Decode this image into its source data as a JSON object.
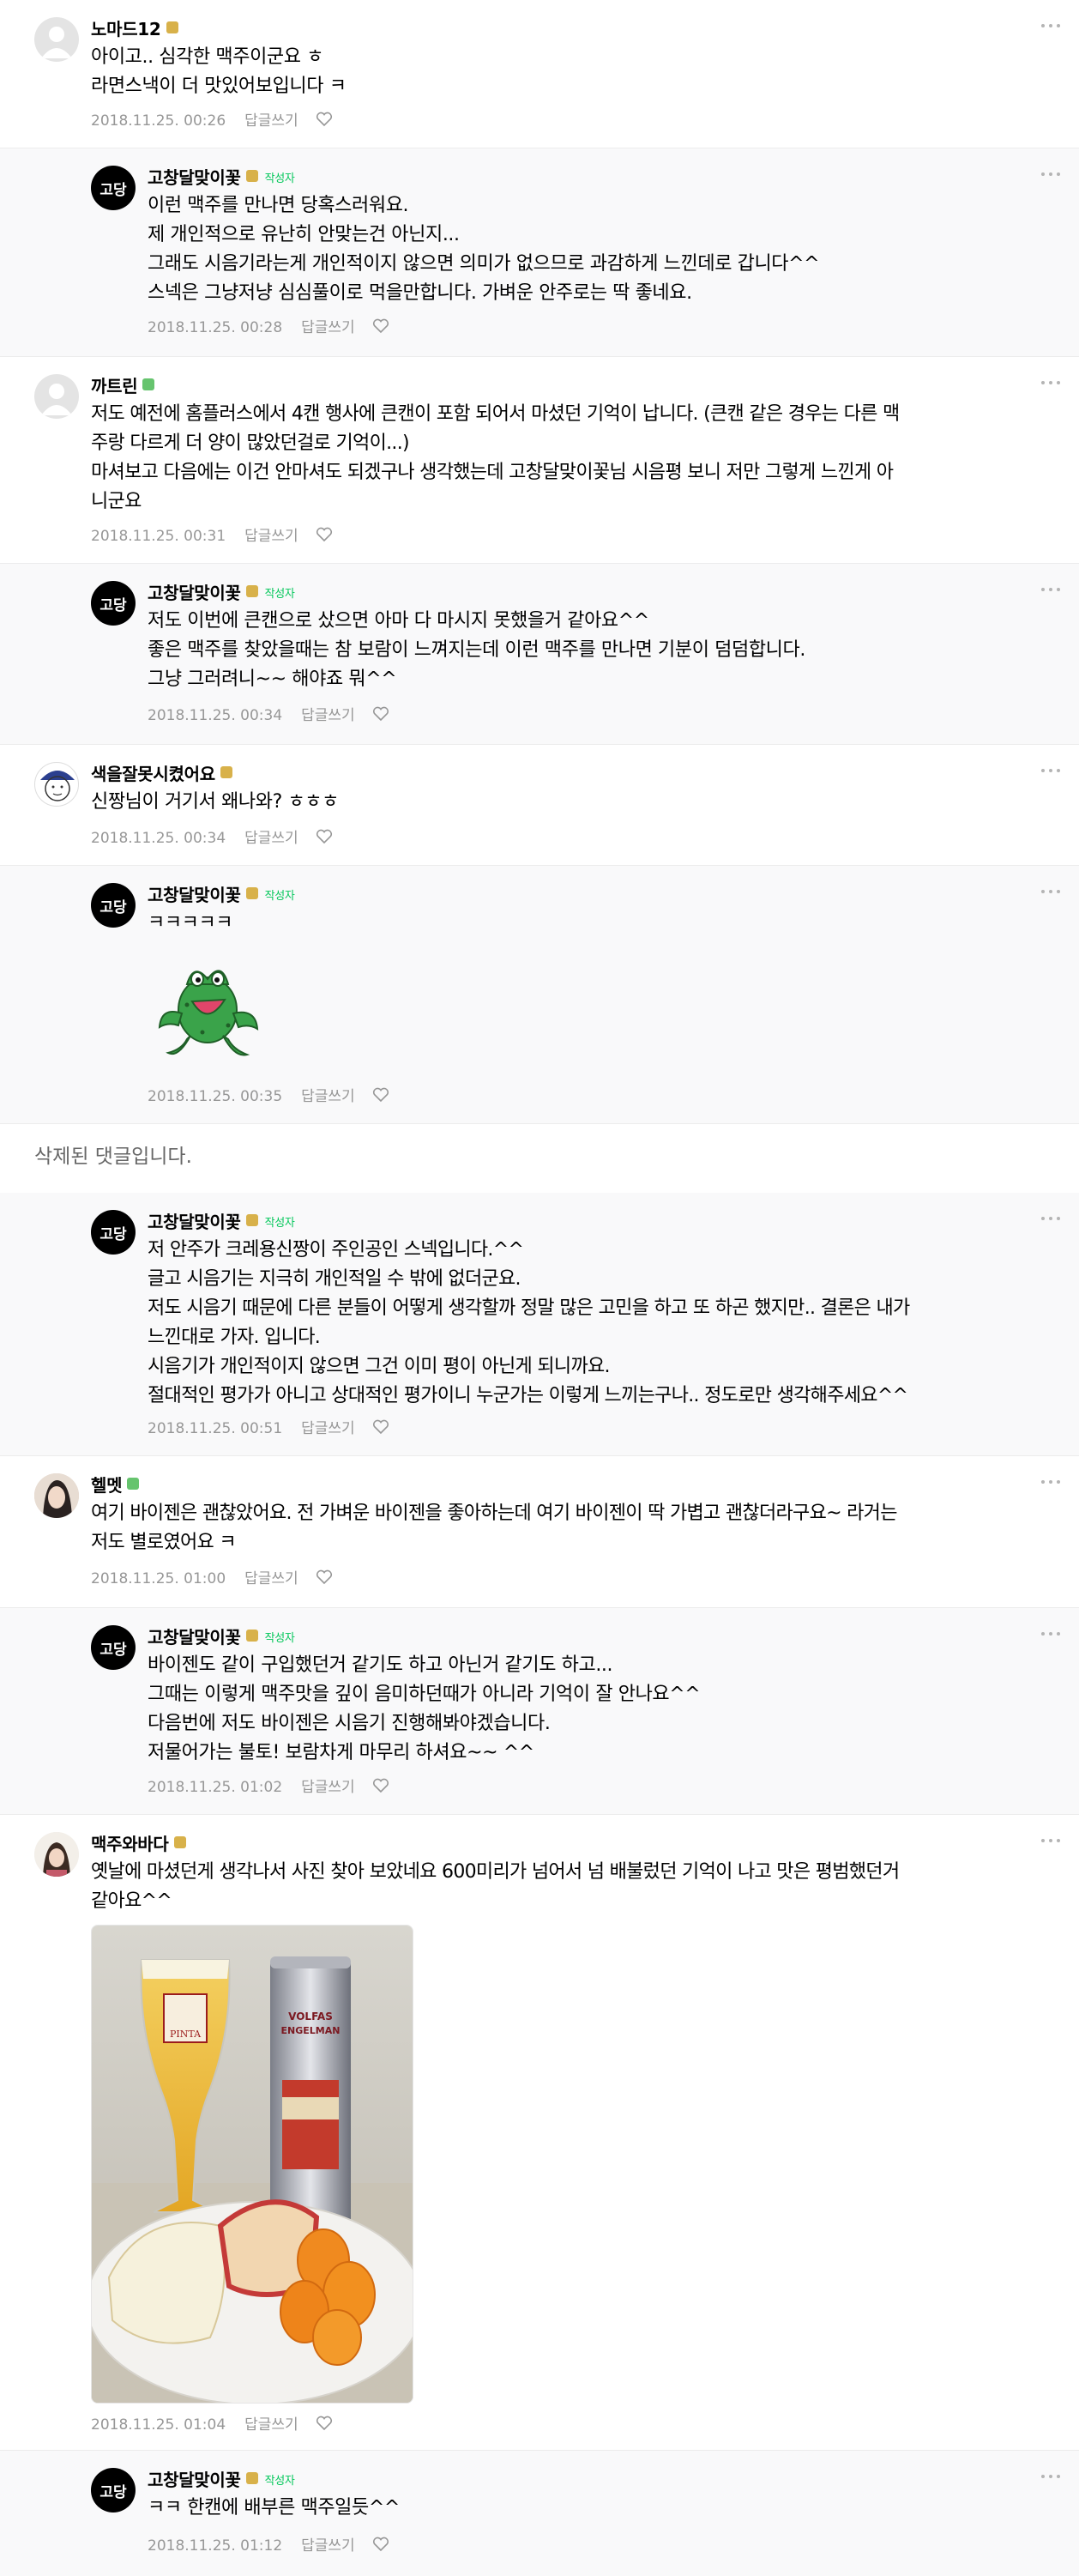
{
  "comments": [
    {
      "nickname": "노마드12",
      "lines": [
        "아이고.. 심각한 맥주이군요 ㅎ",
        "라면스낵이 더 맛있어보입니다 ㅋ"
      ],
      "date": "2018.11.25. 00:26",
      "reply_label": "답글쓰기",
      "grade_color": "#d8b14a"
    },
    {
      "nickname": "고창달맞이꽃",
      "author_tag": "작성자",
      "lines": [
        "이런 맥주를 만나면 당혹스러워요.",
        "제 개인적으로 유난히 안맞는건 아닌지...",
        "그래도 시음기라는게 개인적이지 않으면 의미가 없으므로 과감하게 느낀데로 갑니다^^",
        "스넥은 그냥저냥 심심풀이로 먹을만합니다. 가벼운 안주로는 딱 좋네요."
      ],
      "date": "2018.11.25. 00:28",
      "reply_label": "답글쓰기"
    },
    {
      "nickname": "까트린",
      "lines": [
        "저도 예전에 홈플러스에서 4캔 행사에 큰캔이 포함 되어서 마셨던 기억이 납니다. (큰캔 같은 경우는 다른 맥",
        "주랑 다르게 더 양이 많았던걸로 기억이...)",
        "마셔보고 다음에는 이건 안마셔도 되겠구나 생각했는데 고창달맞이꽃님 시음평 보니 저만 그렇게 느낀게 아",
        "니군요"
      ],
      "date": "2018.11.25. 00:31",
      "reply_label": "답글쓰기",
      "grade_color": "#66c46e"
    },
    {
      "nickname": "고창달맞이꽃",
      "author_tag": "작성자",
      "lines": [
        "저도 이번에 큰캔으로 샀으면 아마 다 마시지 못했을거 같아요^^",
        "좋은 맥주를 찾았을때는 참 보람이 느껴지는데 이런 맥주를 만나면 기분이 덤덤합니다.",
        "그냥 그러려니~~ 해야죠 뭐^^"
      ],
      "date": "2018.11.25. 00:34",
      "reply_label": "답글쓰기"
    },
    {
      "nickname": "색을잘못시켰어요",
      "lines": [
        "신짱님이 거기서 왜나와? ㅎㅎㅎ"
      ],
      "date": "2018.11.25. 00:34",
      "reply_label": "답글쓰기"
    },
    {
      "nickname": "고창달맞이꽃",
      "author_tag": "작성자",
      "lines": [
        "ㅋㅋㅋㅋㅋ"
      ],
      "date": "2018.11.25. 00:35",
      "reply_label": "답글쓰기"
    },
    {
      "deleted_text": "삭제된 댓글입니다."
    },
    {
      "nickname": "고창달맞이꽃",
      "author_tag": "작성자",
      "lines": [
        "저 안주가 크레용신짱이 주인공인 스넥입니다.^^",
        "글고 시음기는 지극히 개인적일 수 밖에 없더군요.",
        "저도 시음기 때문에 다른 분들이 어떻게 생각할까 정말 많은 고민을 하고 또 하곤 했지만.. 결론은 내가",
        "느낀대로 가자. 입니다.",
        "시음기가 개인적이지 않으면 그건 이미 평이 아닌게 되니까요.",
        "절대적인 평가가 아니고 상대적인 평가이니 누군가는 이렇게 느끼는구나.. 정도로만 생각해주세요^^"
      ],
      "date": "2018.11.25. 00:51",
      "reply_label": "답글쓰기"
    },
    {
      "nickname": "헬멧",
      "lines": [
        "여기 바이젠은 괜찮았어요. 전 가벼운 바이젠을 좋아하는데 여기 바이젠이 딱 가볍고 괜찮더라구요~ 라거는",
        "저도 별로였어요 ㅋ"
      ],
      "date": "2018.11.25. 01:00",
      "reply_label": "답글쓰기"
    },
    {
      "nickname": "고창달맞이꽃",
      "author_tag": "작성자",
      "lines": [
        "바이젠도 같이 구입했던거 같기도 하고 아닌거 같기도 하고...",
        "그때는 이렇게 맥주맛을 깊이 음미하던때가 아니라 기억이 잘 안나요^^",
        "다음번에 저도 바이젠은 시음기 진행해봐야겠습니다.",
        "저물어가는 불토! 보람차게 마무리 하셔요~~ ^^"
      ],
      "date": "2018.11.25. 01:02",
      "reply_label": "답글쓰기"
    },
    {
      "nickname": "맥주와바다",
      "lines": [
        "옛날에 마셨던게 생각나서 사진 찾아 보았네요 600미리가 넘어서 넘 배불렀던 기억이 나고 맛은 평범했던거",
        "같아요^^"
      ],
      "photo_can_text": [
        "VOLFAS",
        "ENGELMAN"
      ],
      "date": "2018.11.25. 01:04",
      "reply_label": "답글쓰기"
    },
    {
      "nickname": "고창달맞이꽃",
      "author_tag": "작성자",
      "lines": [
        "ㅋㅋ 한캔에 배부른 맥주일듯^^"
      ],
      "date": "2018.11.25. 01:12",
      "reply_label": "답글쓰기"
    }
  ],
  "logo_text": "고당",
  "colors": {
    "gold_grade": "#d8b14a",
    "green_grade": "#66c46e",
    "author_tag": "#03c75a",
    "meta_gray": "#979797",
    "reply_bg": "#f9f9fa"
  }
}
